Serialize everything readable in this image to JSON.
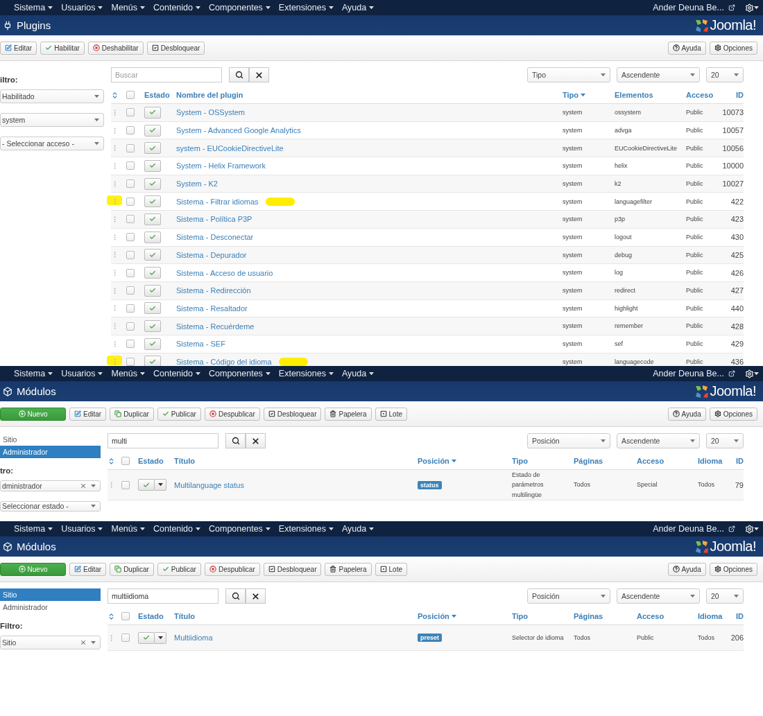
{
  "panels": [
    {
      "kind": "plugins",
      "menus": [
        "Sistema",
        "Usuarios",
        "Menús",
        "Contenido",
        "Componentes",
        "Extensiones",
        "Ayuda"
      ],
      "user": "Ander Deuna Be...",
      "title": "Plugins",
      "brand": "Joomla!",
      "toolbar": [
        {
          "label": "Editar",
          "kind": "edit"
        },
        {
          "label": "Habilitar",
          "kind": "enable"
        },
        {
          "label": "Deshabilitar",
          "kind": "disable"
        },
        {
          "label": "Desbloquear",
          "kind": "unlock"
        }
      ],
      "toolbar_right": [
        {
          "label": "Ayuda",
          "kind": "help"
        },
        {
          "label": "Opciones",
          "kind": "options"
        }
      ],
      "sidebar": {
        "filter_label": "iltro:",
        "selects": [
          {
            "value": "Habilitado",
            "clearable": false
          },
          {
            "value": "system",
            "clearable": false
          },
          {
            "value": "- Seleccionar acceso -",
            "clearable": false
          }
        ]
      },
      "search": {
        "placeholder": "Buscar"
      },
      "sorts": [
        "Tipo",
        "Ascendente",
        "20"
      ],
      "select_all": {
        "checked": false
      },
      "status_column": {
        "label": "Estado",
        "kind": "status"
      },
      "columns": [
        {
          "label": "Nombre del plugin",
          "kind": "link",
          "sorted": false
        },
        {
          "label": "Tipo",
          "kind": "small",
          "sorted": true
        },
        {
          "label": "Elementos",
          "kind": "small",
          "sorted": false
        },
        {
          "label": "Acceso",
          "kind": "small",
          "sorted": false
        },
        {
          "label": "ID",
          "kind": "number",
          "sorted": false
        }
      ],
      "rows": [
        {
          "checked": false,
          "enabled": true,
          "highlighted": false,
          "cells": [
            "System - OSSystem",
            "system",
            "ossystem",
            "Public",
            "10073"
          ]
        },
        {
          "checked": false,
          "enabled": true,
          "highlighted": false,
          "cells": [
            "System - Advanced Google Analytics",
            "system",
            "advga",
            "Public",
            "10057"
          ]
        },
        {
          "checked": false,
          "enabled": true,
          "highlighted": false,
          "cells": [
            "system - EUCookieDirectiveLite",
            "system",
            "EUCookieDirectiveLite",
            "Public",
            "10056"
          ]
        },
        {
          "checked": false,
          "enabled": true,
          "highlighted": false,
          "cells": [
            "System - Helix Framework",
            "system",
            "helix",
            "Public",
            "10000"
          ]
        },
        {
          "checked": false,
          "enabled": true,
          "highlighted": false,
          "cells": [
            "System - K2",
            "system",
            "k2",
            "Public",
            "10027"
          ]
        },
        {
          "checked": false,
          "enabled": true,
          "highlighted": true,
          "cells": [
            "Sistema - Filtrar idiomas",
            "system",
            "languagefilter",
            "Public",
            "422"
          ]
        },
        {
          "checked": false,
          "enabled": true,
          "highlighted": false,
          "cells": [
            "Sistema - Política P3P",
            "system",
            "p3p",
            "Public",
            "423"
          ]
        },
        {
          "checked": false,
          "enabled": true,
          "highlighted": false,
          "cells": [
            "Sistema - Desconectar",
            "system",
            "logout",
            "Public",
            "430"
          ]
        },
        {
          "checked": false,
          "enabled": true,
          "highlighted": false,
          "cells": [
            "Sistema - Depurador",
            "system",
            "debug",
            "Public",
            "425"
          ]
        },
        {
          "checked": false,
          "enabled": true,
          "highlighted": false,
          "cells": [
            "Sistema - Acceso de usuario",
            "system",
            "log",
            "Public",
            "426"
          ]
        },
        {
          "checked": false,
          "enabled": true,
          "highlighted": false,
          "cells": [
            "Sistema - Redirección",
            "system",
            "redirect",
            "Public",
            "427"
          ]
        },
        {
          "checked": false,
          "enabled": true,
          "highlighted": false,
          "cells": [
            "Sistema - Resaltador",
            "system",
            "highlight",
            "Public",
            "440"
          ]
        },
        {
          "checked": false,
          "enabled": true,
          "highlighted": false,
          "cells": [
            "Sistema - Recuérdeme",
            "system",
            "remember",
            "Public",
            "428"
          ]
        },
        {
          "checked": false,
          "enabled": true,
          "highlighted": false,
          "cells": [
            "Sistema - SEF",
            "system",
            "sef",
            "Public",
            "429"
          ]
        },
        {
          "checked": false,
          "enabled": true,
          "highlighted": true,
          "cells": [
            "Sistema - Código del idioma",
            "system",
            "languagecode",
            "Public",
            "436"
          ]
        }
      ]
    },
    {
      "kind": "modules",
      "menus": [
        "Sistema",
        "Usuarios",
        "Menús",
        "Contenido",
        "Componentes",
        "Extensiones",
        "Ayuda"
      ],
      "user": "Ander Deuna Be...",
      "title": "Módulos",
      "brand": "Joomla!",
      "toolbar": [
        {
          "label": "Nuevo",
          "kind": "new"
        },
        {
          "label": "Editar",
          "kind": "edit"
        },
        {
          "label": "Duplicar",
          "kind": "copy"
        },
        {
          "label": "Publicar",
          "kind": "enable"
        },
        {
          "label": "Despublicar",
          "kind": "disable"
        },
        {
          "label": "Desbloquear",
          "kind": "unlock"
        },
        {
          "label": "Papelera",
          "kind": "trash"
        },
        {
          "label": "Lote",
          "kind": "batch"
        }
      ],
      "toolbar_right": [
        {
          "label": "Ayuda",
          "kind": "help"
        },
        {
          "label": "Opciones",
          "kind": "options"
        }
      ],
      "sidebar": {
        "tabs": [
          {
            "label": "Sitio",
            "selected": false
          },
          {
            "label": "Administrador",
            "selected": true
          }
        ],
        "filter_label": "tro:",
        "selects": [
          {
            "value": "dministrador",
            "clearable": true
          },
          {
            "value": "Seleccionar estado -",
            "clearable": false
          }
        ]
      },
      "search": {
        "value": "multi"
      },
      "sorts": [
        "Posición",
        "Ascendente",
        "20"
      ],
      "select_all": {
        "checked": false
      },
      "status_column": {
        "label": "Estado",
        "kind": "status_menu"
      },
      "columns": [
        {
          "label": "Título",
          "kind": "link",
          "sorted": false
        },
        {
          "label": "Posición",
          "kind": "badge",
          "sorted": true
        },
        {
          "label": "Tipo",
          "kind": "small",
          "sorted": false
        },
        {
          "label": "Páginas",
          "kind": "small",
          "sorted": false
        },
        {
          "label": "Acceso",
          "kind": "small",
          "sorted": false
        },
        {
          "label": "Idioma",
          "kind": "small",
          "sorted": false
        },
        {
          "label": "ID",
          "kind": "number",
          "sorted": false
        }
      ],
      "rows": [
        {
          "checked": false,
          "enabled": true,
          "highlighted": false,
          "cells": [
            "Multilanguage status",
            "status",
            "Estado de parámetros multilingüe",
            "Todos",
            "Special",
            "Todos",
            "79"
          ]
        }
      ]
    },
    {
      "kind": "modules",
      "menus": [
        "Sistema",
        "Usuarios",
        "Menús",
        "Contenido",
        "Componentes",
        "Extensiones",
        "Ayuda"
      ],
      "user": "Ander Deuna Be...",
      "title": "Módulos",
      "brand": "Joomla!",
      "toolbar": [
        {
          "label": "Nuevo",
          "kind": "new"
        },
        {
          "label": "Editar",
          "kind": "edit"
        },
        {
          "label": "Duplicar",
          "kind": "copy"
        },
        {
          "label": "Publicar",
          "kind": "enable"
        },
        {
          "label": "Despublicar",
          "kind": "disable"
        },
        {
          "label": "Desbloquear",
          "kind": "unlock"
        },
        {
          "label": "Papelera",
          "kind": "trash"
        },
        {
          "label": "Lote",
          "kind": "batch"
        }
      ],
      "toolbar_right": [
        {
          "label": "Ayuda",
          "kind": "help"
        },
        {
          "label": "Opciones",
          "kind": "options"
        }
      ],
      "sidebar": {
        "tabs": [
          {
            "label": "Sitio",
            "selected": true
          },
          {
            "label": "Administrador",
            "selected": false
          }
        ],
        "filter_label": "Filtro:",
        "selects": [
          {
            "value": "Sitio",
            "clearable": true
          }
        ]
      },
      "search": {
        "value": "multiidioma"
      },
      "sorts": [
        "Posición",
        "Ascendente",
        "20"
      ],
      "select_all": {
        "checked": false
      },
      "status_column": {
        "label": "Estado",
        "kind": "status_menu"
      },
      "columns": [
        {
          "label": "Título",
          "kind": "link",
          "sorted": false
        },
        {
          "label": "Posición",
          "kind": "badge",
          "sorted": true
        },
        {
          "label": "Tipo",
          "kind": "small",
          "sorted": false
        },
        {
          "label": "Páginas",
          "kind": "small",
          "sorted": false
        },
        {
          "label": "Acceso",
          "kind": "small",
          "sorted": false
        },
        {
          "label": "Idioma",
          "kind": "small",
          "sorted": false
        },
        {
          "label": "ID",
          "kind": "number",
          "sorted": false
        }
      ],
      "rows": [
        {
          "checked": false,
          "enabled": true,
          "highlighted": false,
          "cells": [
            "Multiidioma",
            "preset",
            "Selector de idioma",
            "Todos",
            "Public",
            "Todos",
            "206"
          ]
        }
      ]
    }
  ]
}
